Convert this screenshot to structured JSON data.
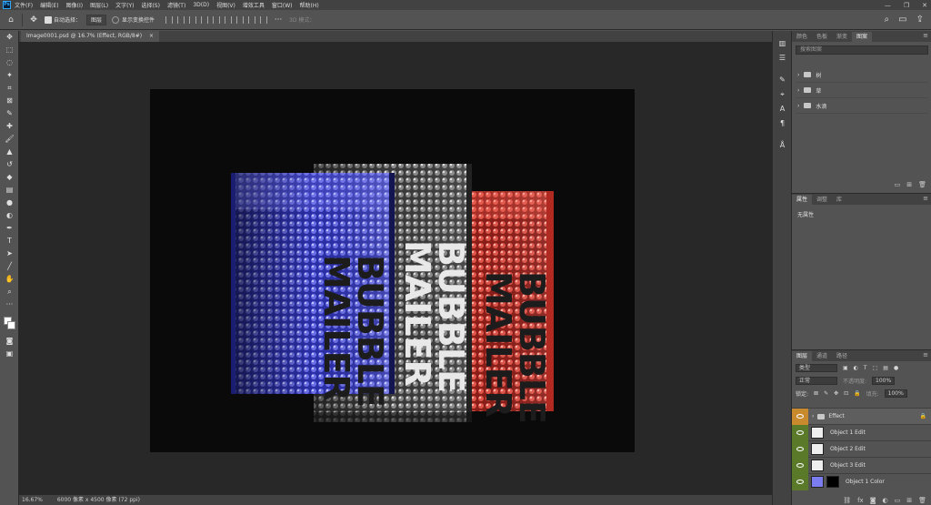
{
  "app": {
    "logo": "Ps"
  },
  "menu": [
    "文件(F)",
    "编辑(E)",
    "图像(I)",
    "图层(L)",
    "文字(Y)",
    "选择(S)",
    "滤镜(T)",
    "3D(D)",
    "视图(V)",
    "增效工具",
    "窗口(W)",
    "帮助(H)"
  ],
  "window_controls": {
    "minimize": "—",
    "restore": "❐",
    "close": "✕"
  },
  "options": {
    "auto_select_label": "自动选择：",
    "auto_select_value": "图层",
    "show_transform_label": "显示变换控件",
    "mode_label": "3D 模式："
  },
  "document": {
    "tab_title": "Image0001.psd @ 16.7% (Effect, RGB/8#)",
    "close_glyph": "×"
  },
  "status": {
    "zoom": "16.67%",
    "doc_size": "6000 像素 x 4500 像素 (72 ppi)"
  },
  "libraries": {
    "tabs": [
      "颜色",
      "色板",
      "渐变",
      "图案"
    ],
    "search_placeholder": "搜索图案",
    "items": [
      "树",
      "草",
      "水滴"
    ]
  },
  "properties": {
    "tabs": [
      "属性",
      "调整",
      "库"
    ],
    "body": "无属性"
  },
  "layers_panel": {
    "tabs": [
      "图层",
      "通道",
      "路径"
    ],
    "kind_label": "类型",
    "blend_mode": "正常",
    "opacity_label": "不透明度:",
    "opacity_value": "100%",
    "lock_label": "锁定:",
    "fill_label": "填充:",
    "fill_value": "100%",
    "layers": [
      {
        "name": "Effect",
        "type": "group"
      },
      {
        "name": "Object 1 Edit",
        "type": "smart"
      },
      {
        "name": "Object 2 Edit",
        "type": "smart"
      },
      {
        "name": "Object 3 Edit",
        "type": "smart"
      },
      {
        "name": "Object 1 Color",
        "type": "fill"
      }
    ]
  },
  "artwork": {
    "text_line1": "BUBBLE",
    "text_line2": "MAILER",
    "colors": {
      "blue": "#3a3fc8",
      "gray": "#7a7a7a",
      "red": "#d8443a"
    }
  }
}
